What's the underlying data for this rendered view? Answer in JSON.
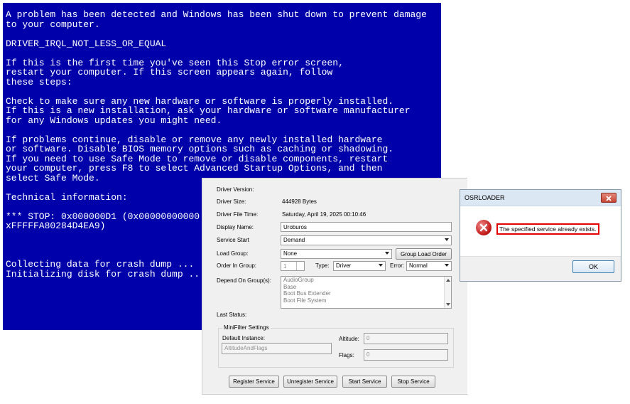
{
  "bsod": {
    "text": "A problem has been detected and Windows has been shut down to prevent damage\nto your computer.\n\nDRIVER_IRQL_NOT_LESS_OR_EQUAL\n\nIf this is the first time you've seen this Stop error screen,\nrestart your computer. If this screen appears again, follow\nthese steps:\n\nCheck to make sure any new hardware or software is properly installed.\nIf this is a new installation, ask your hardware or software manufacturer\nfor any Windows updates you might need.\n\nIf problems continue, disable or remove any newly installed hardware\nor software. Disable BIOS memory options such as caching or shadowing.\nIf you need to use Safe Mode to remove or disable components, restart\nyour computer, press F8 to select Advanced Startup Options, and then\nselect Safe Mode.\n\nTechnical information:\n\n*** STOP: 0x000000D1 (0x00000000000\nxFFFFFA80284D4EA9)\n\n\n\nCollecting data for crash dump ...\nInitializing disk for crash dump ...",
    "background_color": "#0000aa"
  },
  "panel": {
    "driver_version_label": "Driver Version:",
    "driver_size_label": "Driver Size:",
    "driver_size_value": "444928 Bytes",
    "driver_file_time_label": "Driver File Time:",
    "driver_file_time_value": "Saturday, April 19, 2025 00:10:46",
    "display_name_label": "Display Name:",
    "display_name_value": "Uroburos",
    "service_start_label": "Service Start",
    "service_start_value": "Demand",
    "load_group_label": "Load Group:",
    "load_group_value": "None",
    "group_load_order_button": "Group Load Order",
    "order_in_group_label": "Order In Group:",
    "order_in_group_value": "1",
    "type_label": "Type:",
    "type_value": "Driver",
    "error_label": "Error:",
    "error_value": "Normal",
    "depend_on_groups_label": "Depend On Group(s):",
    "depend_on_groups_items": [
      "AudioGroup",
      "Base",
      "Boot Bus Extender",
      "Boot File System"
    ],
    "last_status_label": "Last Status:",
    "minifilter_label": "MiniFilter Settings",
    "default_instance_label": "Default Instance:",
    "default_instance_value": "AltitudeAndFlags",
    "altitude_label": "Altitude:",
    "altitude_value": "0",
    "flags_label": "Flags:",
    "flags_value": "0",
    "register_button": "Register Service",
    "unregister_button": "Unregister Service",
    "start_button": "Start Service",
    "stop_button": "Stop Service"
  },
  "dialog": {
    "title": "OSRLOADER",
    "message": "The specified service already exists.",
    "ok_button": "OK",
    "icon": "error-icon",
    "highlight_color": "#e30000"
  }
}
